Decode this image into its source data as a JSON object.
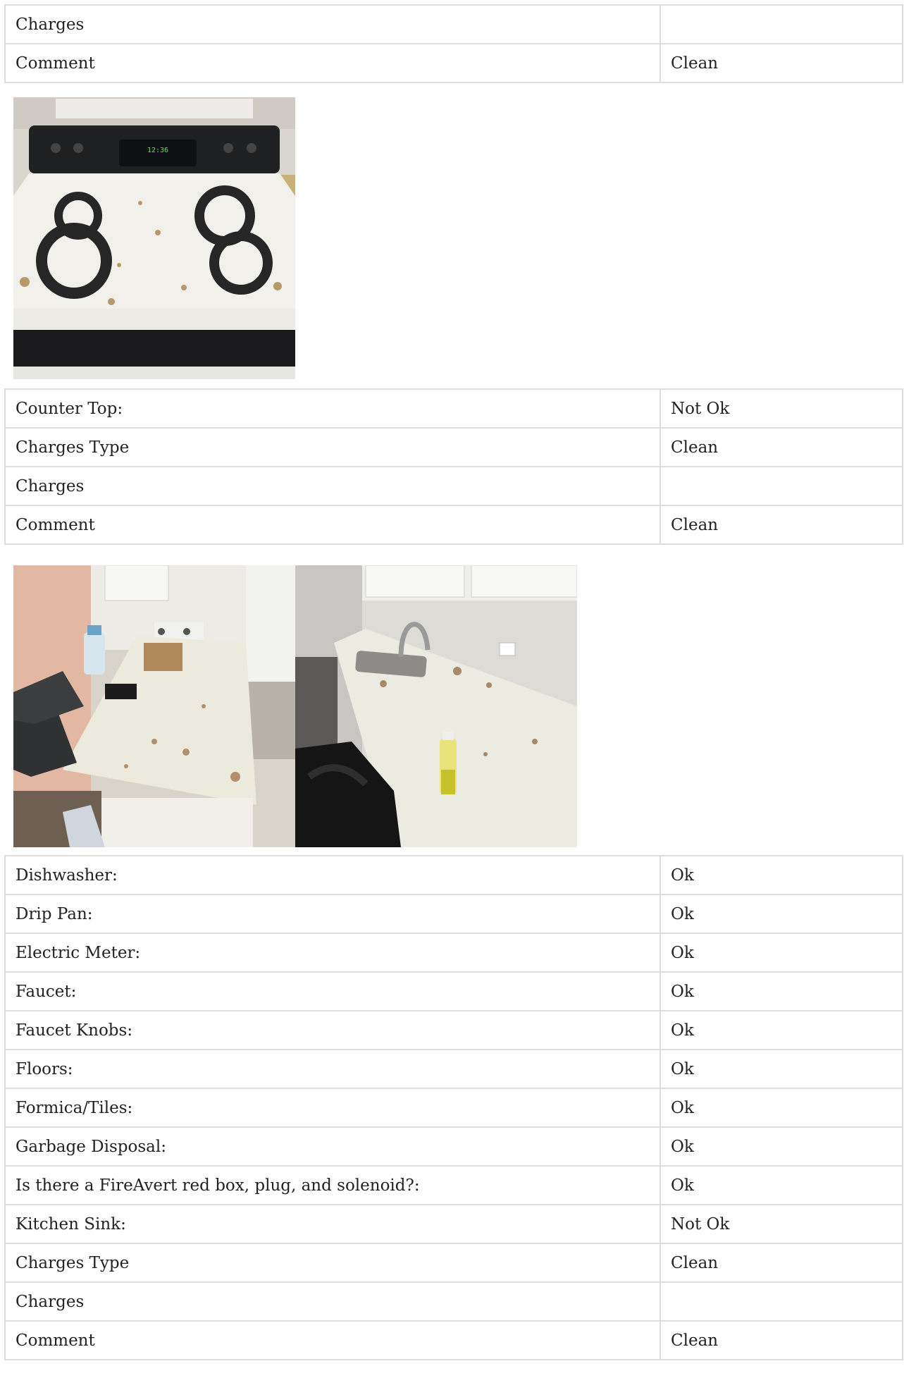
{
  "section_top": {
    "rows": [
      {
        "label": "Charges",
        "value": ""
      },
      {
        "label": "Comment",
        "value": "Clean"
      }
    ],
    "photos": [
      {
        "alt": "Photo of electric stove top",
        "clock": "12:36"
      }
    ]
  },
  "counter_top": {
    "rows": [
      {
        "label": "Counter Top:",
        "value": "Not Ok"
      },
      {
        "label": "Charges Type",
        "value": "Clean"
      },
      {
        "label": "Charges",
        "value": ""
      },
      {
        "label": "Comment",
        "value": "Clean"
      }
    ],
    "photos": [
      {
        "alt": "Photo of kitchen counter near stove"
      },
      {
        "alt": "Photo of kitchen counter with sink"
      }
    ]
  },
  "kitchen_items": {
    "rows": [
      {
        "label": "Dishwasher:",
        "value": "Ok"
      },
      {
        "label": "Drip Pan:",
        "value": "Ok"
      },
      {
        "label": "Electric Meter:",
        "value": "Ok"
      },
      {
        "label": "Faucet:",
        "value": "Ok"
      },
      {
        "label": "Faucet Knobs:",
        "value": "Ok"
      },
      {
        "label": "Floors:",
        "value": "Ok"
      },
      {
        "label": "Formica/Tiles:",
        "value": "Ok"
      },
      {
        "label": "Garbage Disposal:",
        "value": "Ok"
      },
      {
        "label": "Is there a FireAvert red box, plug, and solenoid?:",
        "value": "Ok"
      },
      {
        "label": "Kitchen Sink:",
        "value": "Not Ok"
      },
      {
        "label": "Charges Type",
        "value": "Clean"
      },
      {
        "label": "Charges",
        "value": ""
      },
      {
        "label": "Comment",
        "value": "Clean"
      }
    ]
  },
  "colors": {
    "border": "#dcdcdc",
    "text": "#222222",
    "background": "#ffffff"
  }
}
